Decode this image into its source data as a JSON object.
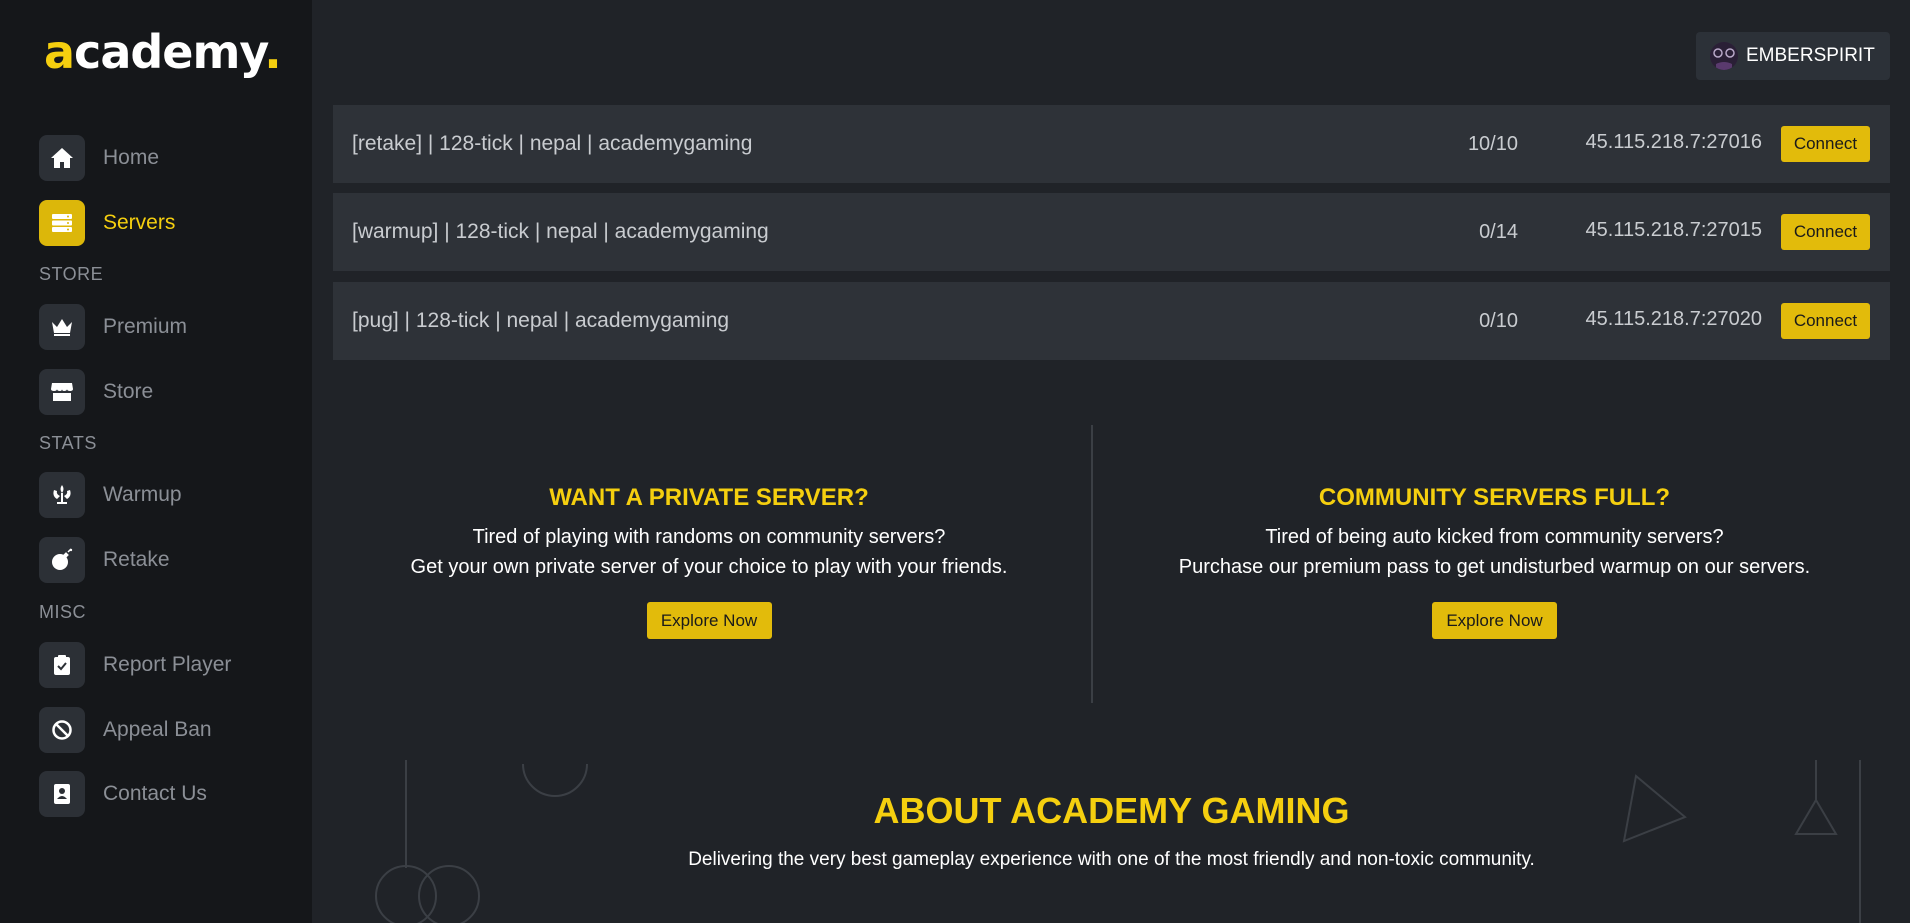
{
  "brand": {
    "logo_a": "a",
    "logo_rest": "cademy",
    "logo_dot": ".",
    "accent_color": "#f5cf0f"
  },
  "sidebar": {
    "items": [
      {
        "label": "Home",
        "icon": "home-icon"
      },
      {
        "label": "Servers",
        "icon": "servers-icon",
        "active": true
      }
    ],
    "sections": [
      {
        "label": "STORE",
        "items": [
          {
            "label": "Premium",
            "icon": "crown-icon"
          },
          {
            "label": "Store",
            "icon": "store-icon"
          }
        ]
      },
      {
        "label": "STATS",
        "items": [
          {
            "label": "Warmup",
            "icon": "emblem-icon"
          },
          {
            "label": "Retake",
            "icon": "bomb-icon"
          }
        ]
      },
      {
        "label": "MISC",
        "items": [
          {
            "label": "Report Player",
            "icon": "clipboard-check-icon"
          },
          {
            "label": "Appeal Ban",
            "icon": "ban-icon"
          },
          {
            "label": "Contact Us",
            "icon": "contact-book-icon"
          }
        ]
      }
    ]
  },
  "user": {
    "name": "EMBERSPIRIT"
  },
  "servers": [
    {
      "name": "[retake] | 128-tick | nepal | academygaming",
      "players": "10/10",
      "ip": "45.115.218.7:27016",
      "action": "Connect"
    },
    {
      "name": "[warmup] | 128-tick | nepal | academygaming",
      "players": "0/14",
      "ip": "45.115.218.7:27015",
      "action": "Connect"
    },
    {
      "name": "[pug] | 128-tick | nepal | academygaming",
      "players": "0/10",
      "ip": "45.115.218.7:27020",
      "action": "Connect"
    }
  ],
  "promos": [
    {
      "title": "WANT A PRIVATE SERVER?",
      "line1": "Tired of playing with randoms on community servers?",
      "line2": "Get your own private server of your choice to play with your friends.",
      "button": "Explore Now"
    },
    {
      "title": "COMMUNITY SERVERS FULL?",
      "line1": "Tired of being auto kicked from community servers?",
      "line2": "Purchase our premium pass to get undisturbed warmup on our servers.",
      "button": "Explore Now"
    }
  ],
  "about": {
    "title": "ABOUT ACADEMY GAMING",
    "text": "Delivering the very best gameplay experience with one of the most friendly and non-toxic community."
  }
}
